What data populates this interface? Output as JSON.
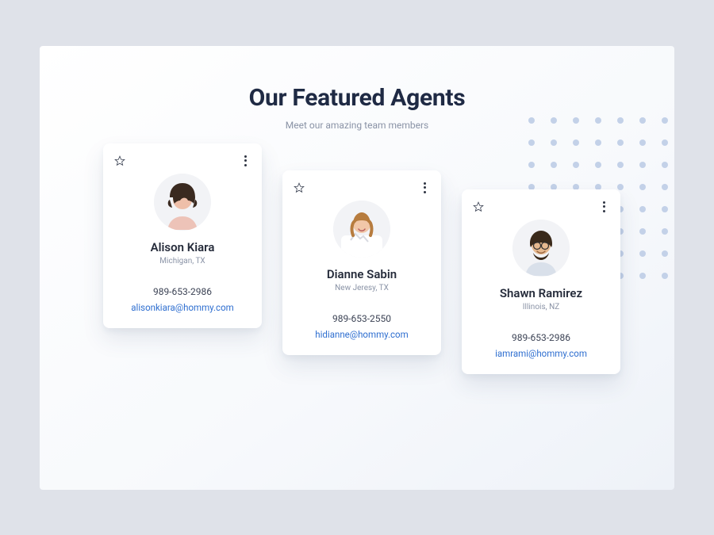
{
  "header": {
    "title": "Our Featured Agents",
    "subtitle": "Meet our amazing team members"
  },
  "agents": [
    {
      "name": "Alison Kiara",
      "location": "Michigan, TX",
      "phone": "989-653-2986",
      "email": "alisonkiara@hommy.com"
    },
    {
      "name": "Dianne Sabin",
      "location": "New Jeresy, TX",
      "phone": "989-653-2550",
      "email": "hidianne@hommy.com"
    },
    {
      "name": "Shawn Ramirez",
      "location": "Illinois, NZ",
      "phone": "989-653-2986",
      "email": "iamrami@hommy.com"
    }
  ]
}
